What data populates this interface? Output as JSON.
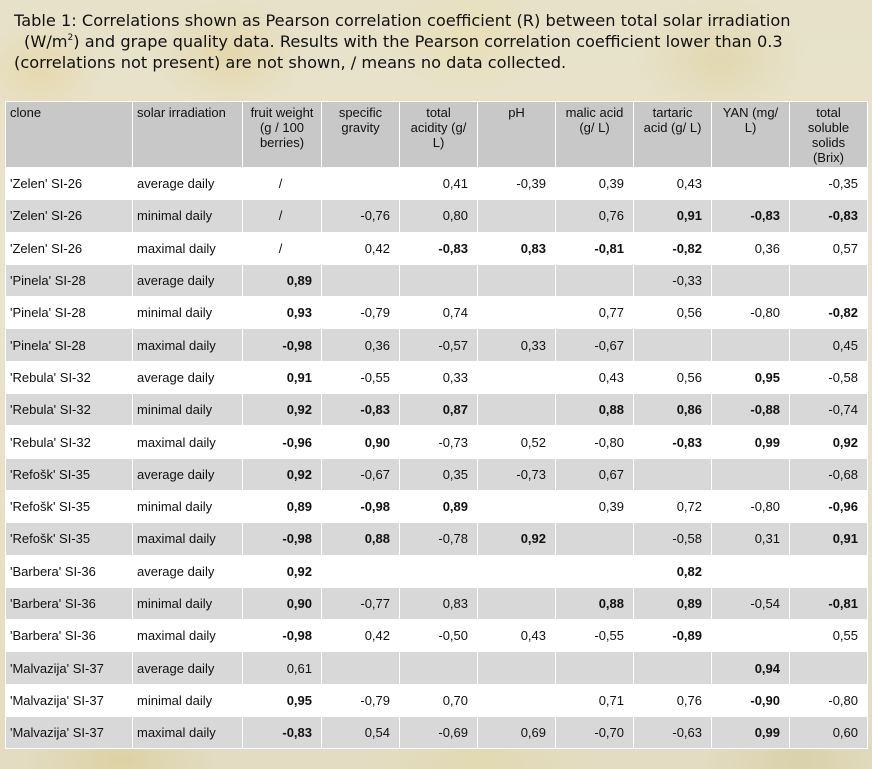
{
  "caption": {
    "line1": "Table 1: Correlations shown as Pearson correlation coefficient (R) between total solar irradiation",
    "line2_pre": "(W/m",
    "line2_sup": "2",
    "line2_post": ") and grape quality data. Results with the Pearson correlation coefficient lower than 0.3",
    "line3": "(correlations not present) are not shown, / means no data collected."
  },
  "headers": {
    "clone": "clone",
    "solar_irradiation": "solar irradiation",
    "fruit_weight": "fruit weight (g / 100 berries)",
    "specific_gravity": "specific gravity",
    "total_acidity": "total acidity (g/ L)",
    "ph": "pH",
    "malic_acid": "malic acid (g/ L)",
    "tartaric_acid": "tartaric acid (g/ L)",
    "yan": "YAN (mg/ L)",
    "total_soluble_solids": "total soluble solids (Brix)"
  },
  "rows": [
    {
      "clone": "'Zelen' SI-26",
      "irr": "average daily",
      "fw": "/",
      "sg": "",
      "ta": "0,41",
      "ph": "-0,39",
      "ma": "0,39",
      "tar": "0,43",
      "yan": "",
      "tss": "-0,35"
    },
    {
      "clone": "'Zelen' SI-26",
      "irr": "minimal daily",
      "fw": "/",
      "sg": "-0,76",
      "ta": "0,80",
      "ph": "",
      "ma": "0,76",
      "tar": "0,91",
      "yan": "-0,83",
      "tss": "-0,83"
    },
    {
      "clone": "'Zelen' SI-26",
      "irr": "maximal daily",
      "fw": "/",
      "sg": "0,42",
      "ta": "-0,83",
      "ph": "0,83",
      "ma": "-0,81",
      "tar": "-0,82",
      "yan": "0,36",
      "tss": "0,57"
    },
    {
      "clone": "'Pinela' SI-28",
      "irr": "average daily",
      "fw": "0,89",
      "sg": "",
      "ta": "",
      "ph": "",
      "ma": "",
      "tar": "-0,33",
      "yan": "",
      "tss": ""
    },
    {
      "clone": "'Pinela' SI-28",
      "irr": "minimal daily",
      "fw": "0,93",
      "sg": "-0,79",
      "ta": "0,74",
      "ph": "",
      "ma": "0,77",
      "tar": "0,56",
      "yan": "-0,80",
      "tss": "-0,82"
    },
    {
      "clone": "'Pinela' SI-28",
      "irr": "maximal daily",
      "fw": "-0,98",
      "sg": "0,36",
      "ta": "-0,57",
      "ph": "0,33",
      "ma": "-0,67",
      "tar": "",
      "yan": "",
      "tss": "0,45"
    },
    {
      "clone": "'Rebula' SI-32",
      "irr": "average daily",
      "fw": "0,91",
      "sg": "-0,55",
      "ta": "0,33",
      "ph": "",
      "ma": "0,43",
      "tar": "0,56",
      "yan": "0,95",
      "tss": "-0,58"
    },
    {
      "clone": "'Rebula' SI-32",
      "irr": "minimal daily",
      "fw": "0,92",
      "sg": "-0,83",
      "ta": "0,87",
      "ph": "",
      "ma": "0,88",
      "tar": "0,86",
      "yan": "-0,88",
      "tss": "-0,74"
    },
    {
      "clone": "'Rebula' SI-32",
      "irr": "maximal daily",
      "fw": "-0,96",
      "sg": "0,90",
      "ta": "-0,73",
      "ph": "0,52",
      "ma": "-0,80",
      "tar": "-0,83",
      "yan": "0,99",
      "tss": "0,92"
    },
    {
      "clone": "'Refošk' SI-35",
      "irr": "average daily",
      "fw": "0,92",
      "sg": "-0,67",
      "ta": "0,35",
      "ph": "-0,73",
      "ma": "0,67",
      "tar": "",
      "yan": "",
      "tss": "-0,68"
    },
    {
      "clone": "'Refošk' SI-35",
      "irr": "minimal daily",
      "fw": "0,89",
      "sg": "-0,98",
      "ta": "0,89",
      "ph": "",
      "ma": "0,39",
      "tar": "0,72",
      "yan": "-0,80",
      "tss": "-0,96"
    },
    {
      "clone": "'Refošk' SI-35",
      "irr": "maximal daily",
      "fw": "-0,98",
      "sg": "0,88",
      "ta": "-0,78",
      "ph": "0,92",
      "ma": "",
      "tar": "-0,58",
      "yan": "0,31",
      "tss": "0,91"
    },
    {
      "clone": "'Barbera' SI-36",
      "irr": "average daily",
      "fw": "0,92",
      "sg": "",
      "ta": "",
      "ph": "",
      "ma": "",
      "tar": "0,82",
      "yan": "",
      "tss": ""
    },
    {
      "clone": "'Barbera' SI-36",
      "irr": "minimal daily",
      "fw": "0,90",
      "sg": "-0,77",
      "ta": "0,83",
      "ph": "",
      "ma": "0,88",
      "tar": "0,89",
      "yan": "-0,54",
      "tss": "-0,81"
    },
    {
      "clone": "'Barbera' SI-36",
      "irr": "maximal daily",
      "fw": "-0,98",
      "sg": "0,42",
      "ta": "-0,50",
      "ph": "0,43",
      "ma": "-0,55",
      "tar": "-0,89",
      "yan": "",
      "tss": "0,55"
    },
    {
      "clone": "'Malvazija' SI-37",
      "irr": "average daily",
      "fw": "0,61",
      "sg": "",
      "ta": "",
      "ph": "",
      "ma": "",
      "tar": "",
      "yan": "0,94",
      "tss": ""
    },
    {
      "clone": "'Malvazija' SI-37",
      "irr": "minimal daily",
      "fw": "0,95",
      "sg": "-0,79",
      "ta": "0,70",
      "ph": "",
      "ma": "0,71",
      "tar": "0,76",
      "yan": "-0,90",
      "tss": "-0,80"
    },
    {
      "clone": "'Malvazija' SI-37",
      "irr": "maximal daily",
      "fw": "-0,83",
      "sg": "0,54",
      "ta": "-0,69",
      "ph": "0,69",
      "ma": "-0,70",
      "tar": "-0,63",
      "yan": "0,99",
      "tss": "0,60"
    }
  ],
  "bold": [
    {
      "fw": false,
      "sg": false,
      "ta": false,
      "ph": false,
      "ma": false,
      "tar": false,
      "yan": false,
      "tss": false
    },
    {
      "fw": false,
      "sg": false,
      "ta": false,
      "ph": false,
      "ma": false,
      "tar": true,
      "yan": true,
      "tss": true
    },
    {
      "fw": false,
      "sg": false,
      "ta": true,
      "ph": true,
      "ma": true,
      "tar": true,
      "yan": false,
      "tss": false
    },
    {
      "fw": true,
      "sg": false,
      "ta": false,
      "ph": false,
      "ma": false,
      "tar": false,
      "yan": false,
      "tss": false
    },
    {
      "fw": true,
      "sg": false,
      "ta": false,
      "ph": false,
      "ma": false,
      "tar": false,
      "yan": false,
      "tss": true
    },
    {
      "fw": true,
      "sg": false,
      "ta": false,
      "ph": false,
      "ma": false,
      "tar": false,
      "yan": false,
      "tss": false
    },
    {
      "fw": true,
      "sg": false,
      "ta": false,
      "ph": false,
      "ma": false,
      "tar": false,
      "yan": true,
      "tss": false
    },
    {
      "fw": true,
      "sg": true,
      "ta": true,
      "ph": false,
      "ma": true,
      "tar": true,
      "yan": true,
      "tss": false
    },
    {
      "fw": true,
      "sg": true,
      "ta": false,
      "ph": false,
      "ma": false,
      "tar": true,
      "yan": true,
      "tss": true
    },
    {
      "fw": true,
      "sg": false,
      "ta": false,
      "ph": false,
      "ma": false,
      "tar": false,
      "yan": false,
      "tss": false
    },
    {
      "fw": true,
      "sg": true,
      "ta": true,
      "ph": false,
      "ma": false,
      "tar": false,
      "yan": false,
      "tss": true
    },
    {
      "fw": true,
      "sg": true,
      "ta": false,
      "ph": true,
      "ma": false,
      "tar": false,
      "yan": false,
      "tss": true
    },
    {
      "fw": true,
      "sg": false,
      "ta": false,
      "ph": false,
      "ma": false,
      "tar": true,
      "yan": false,
      "tss": false
    },
    {
      "fw": true,
      "sg": false,
      "ta": false,
      "ph": false,
      "ma": true,
      "tar": true,
      "yan": false,
      "tss": true
    },
    {
      "fw": true,
      "sg": false,
      "ta": false,
      "ph": false,
      "ma": false,
      "tar": true,
      "yan": false,
      "tss": false
    },
    {
      "fw": false,
      "sg": false,
      "ta": false,
      "ph": false,
      "ma": false,
      "tar": false,
      "yan": true,
      "tss": false
    },
    {
      "fw": true,
      "sg": false,
      "ta": false,
      "ph": false,
      "ma": false,
      "tar": false,
      "yan": true,
      "tss": false
    },
    {
      "fw": true,
      "sg": false,
      "ta": false,
      "ph": false,
      "ma": false,
      "tar": false,
      "yan": true,
      "tss": false
    }
  ]
}
